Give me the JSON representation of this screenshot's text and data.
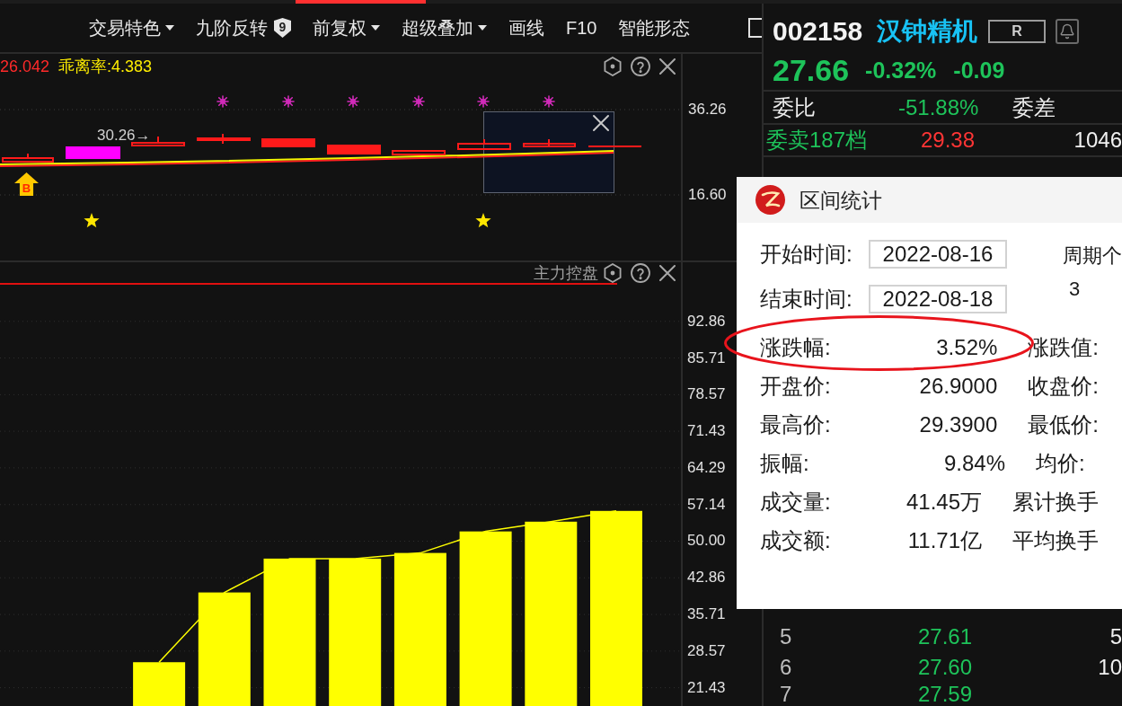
{
  "toolbar": {
    "items": [
      {
        "kind": "dropdown",
        "label": "交易特色"
      },
      {
        "kind": "badge",
        "label": "九阶反转",
        "badge": "9"
      },
      {
        "kind": "dropdown",
        "label": "前复权"
      },
      {
        "kind": "dropdown",
        "label": "超级叠加"
      },
      {
        "kind": "plain",
        "label": "画线"
      },
      {
        "kind": "plain",
        "label": "F10"
      },
      {
        "kind": "plain",
        "label": "智能形态"
      },
      {
        "kind": "checkbox",
        "checked": false
      }
    ]
  },
  "price_chart": {
    "legend": [
      {
        "text": "26.042",
        "color": "#ff2a2a"
      },
      {
        "text": "乖离率:4.383",
        "color": "#ffee00"
      }
    ],
    "axis_labels": [
      "36.26",
      "16.60"
    ],
    "price_tag": "30.26→",
    "buy_marker": "B"
  },
  "indicator_chart": {
    "chart_data": {
      "type": "bar",
      "title": "主力控盘",
      "ylim": [
        17.86,
        100
      ],
      "yticks": [
        92.86,
        85.71,
        78.57,
        71.43,
        64.29,
        57.14,
        {
          "value": 50,
          "label": "50.00"
        },
        42.86,
        35.71,
        28.57,
        21.43
      ],
      "grid": true,
      "series": [
        {
          "color": "#ffff00",
          "values": [
            null,
            null,
            26.4,
            40.0,
            46.6,
            46.6,
            47.7,
            51.9,
            53.8,
            55.9
          ]
        }
      ]
    }
  },
  "quote": {
    "code": "002158",
    "name": "汉钟精机",
    "badge": "R",
    "price": "27.66",
    "change_pct": "-0.32%",
    "change": "-0.09"
  },
  "order_book": {
    "ratio": {
      "label": "委比",
      "value": "-51.88%",
      "diff_label": "委差"
    },
    "ask_total": {
      "label": "委卖187档",
      "price": "29.38",
      "volume": "1046"
    },
    "levels": [
      {
        "level": "5",
        "price": "27.61",
        "volume": "5"
      },
      {
        "level": "6",
        "price": "27.60",
        "volume": "10"
      },
      {
        "level": "7",
        "price": "27.59"
      }
    ]
  },
  "interval_dialog": {
    "title": "区间统计",
    "start": {
      "label": "开始时间:",
      "value": "2022-08-16"
    },
    "end": {
      "label": "结束时间:",
      "value": "2022-08-18"
    },
    "period": {
      "label": "周期个",
      "value": "3"
    },
    "stats": [
      {
        "label": "涨跌幅:",
        "value": "3.52%",
        "right_label": "涨跌值:",
        "highlighted": true
      },
      {
        "label": "开盘价:",
        "value": "26.9000",
        "right_label": "收盘价:",
        "highlighted": false
      },
      {
        "label": "最高价:",
        "value": "29.3900",
        "right_label": "最低价:",
        "highlighted": false
      },
      {
        "label": "振幅:",
        "value": "9.84%",
        "right_label": "均价:",
        "highlighted": false
      },
      {
        "label": "成交量:",
        "value": "41.45万",
        "right_label": "累计换手",
        "highlighted": false
      },
      {
        "label": "成交额:",
        "value": "11.71亿",
        "right_label": "平均换手",
        "highlighted": false
      }
    ]
  }
}
